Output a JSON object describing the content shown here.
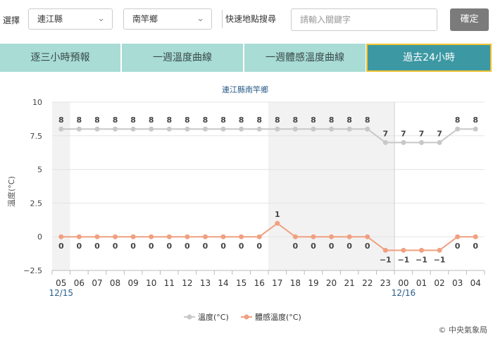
{
  "filters": {
    "select_label": "選擇",
    "county": "連江縣",
    "township": "南竿鄉",
    "quick_search_label": "快速地點搜尋",
    "search_placeholder": "請輸入關鍵字",
    "confirm_button": "確定"
  },
  "tabs": [
    {
      "label": "逐三小時預報",
      "active": false
    },
    {
      "label": "一週溫度曲線",
      "active": false
    },
    {
      "label": "一週體感溫度曲線",
      "active": false
    },
    {
      "label": "過去24小時",
      "active": true
    }
  ],
  "credit": "© 中央氣象局",
  "colors": {
    "temperature": "#c8c8c8",
    "apparent": "#f0a080",
    "active_tab": "#3c98a3",
    "tab": "#a8dcd5"
  },
  "chart_data": {
    "type": "line",
    "title": "連江縣南竿鄉",
    "ylabel": "溫度(°C)",
    "xlabel": "",
    "ylim": [
      -2.5,
      10
    ],
    "yticks": [
      "10",
      "7.5",
      "5",
      "2.5",
      "0",
      "−2.5"
    ],
    "categories": [
      "05",
      "06",
      "07",
      "08",
      "09",
      "10",
      "11",
      "12",
      "13",
      "14",
      "15",
      "16",
      "17",
      "18",
      "19",
      "20",
      "21",
      "22",
      "23",
      "00",
      "01",
      "02",
      "03",
      "04"
    ],
    "date_labels": [
      {
        "at": "05",
        "label": "12/15"
      },
      {
        "at": "00",
        "label": "12/16"
      }
    ],
    "series": [
      {
        "name": "溫度(°C)",
        "values": [
          8,
          8,
          8,
          8,
          8,
          8,
          8,
          8,
          8,
          8,
          8,
          8,
          8,
          8,
          8,
          8,
          8,
          8,
          7,
          7,
          7,
          7,
          8,
          8
        ],
        "labels": [
          "8",
          "8",
          "8",
          "8",
          "8",
          "8",
          "8",
          "8",
          "8",
          "8",
          "8",
          "8",
          "8",
          "8",
          "8",
          "8",
          "8",
          "8",
          "7",
          "7",
          "7",
          "7",
          "8",
          "8"
        ]
      },
      {
        "name": "體感溫度(°C)",
        "values": [
          0,
          0,
          0,
          0,
          0,
          0,
          0,
          0,
          0,
          0,
          0,
          0,
          1,
          0,
          0,
          0,
          0,
          0,
          -1,
          -1,
          -1,
          -1,
          0,
          0
        ],
        "labels": [
          "0",
          "0",
          "0",
          "0",
          "0",
          "0",
          "0",
          "0",
          "0",
          "0",
          "0",
          "0",
          "1",
          "0",
          "0",
          "0",
          "0",
          "0",
          "−1",
          "−1",
          "−1",
          "−1",
          "0",
          "0"
        ]
      }
    ],
    "legend_position": "bottom-center",
    "grid": true
  }
}
